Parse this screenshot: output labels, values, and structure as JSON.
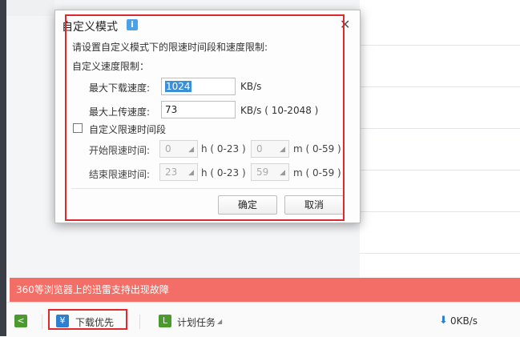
{
  "dialog": {
    "title": "自定义模式",
    "close_glyph": "✕",
    "info_glyph": "i",
    "description": "请设置自定义模式下的限速时间段和速度限制:",
    "speed_section": "自定义速度限制：",
    "download_label": "最大下载速度:",
    "download_value": "1024",
    "download_unit": "KB/s",
    "upload_label": "最大上传速度:",
    "upload_value": "73",
    "upload_unit": "KB/s ( 10-2048 )",
    "time_checkbox_label": "自定义限速时间段",
    "start_label": "开始限速时间:",
    "start_hour": "0",
    "start_minute": "0",
    "end_label": "结束限速时间:",
    "end_hour": "23",
    "end_minute": "59",
    "hour_unit": "h ( 0-23 )",
    "minute_unit": "m ( 0-59 )",
    "ok_label": "确定",
    "cancel_label": "取消"
  },
  "notice": "360等浏览器上的迅雷支持出现故障",
  "bottom_bar": {
    "back_glyph": "<",
    "priority_label": "下载优先",
    "schedule_label": "计划任务",
    "speed_value": "0KB/s"
  },
  "colors": {
    "highlight": "#e0292e",
    "notice_bg": "#f26e66",
    "green_icon": "#4a9a2e",
    "blue_icon": "#2f7fcf"
  }
}
